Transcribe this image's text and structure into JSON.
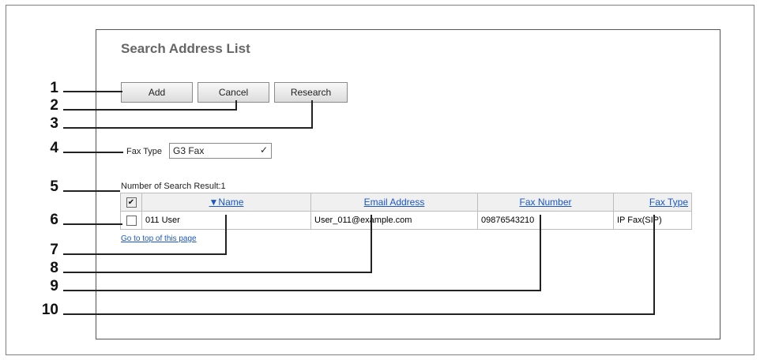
{
  "page": {
    "title": "Search Address List"
  },
  "buttons": {
    "add": "Add",
    "cancel": "Cancel",
    "research": "Research"
  },
  "fax_type": {
    "label": "Fax Type",
    "selected": "G3 Fax"
  },
  "result_summary": "Number of Search Result:1",
  "table": {
    "headers": {
      "name": "▼Name",
      "email": "Email Address",
      "fax_number": "Fax Number",
      "fax_type": "Fax Type"
    },
    "rows": [
      {
        "name": "011 User",
        "email": "User_011@example.com",
        "fax_number": "09876543210",
        "fax_type": "IP Fax(SIP)"
      }
    ]
  },
  "go_top_link": "Go to top of this page",
  "callouts": [
    "1",
    "2",
    "3",
    "4",
    "5",
    "6",
    "7",
    "8",
    "9",
    "10"
  ]
}
